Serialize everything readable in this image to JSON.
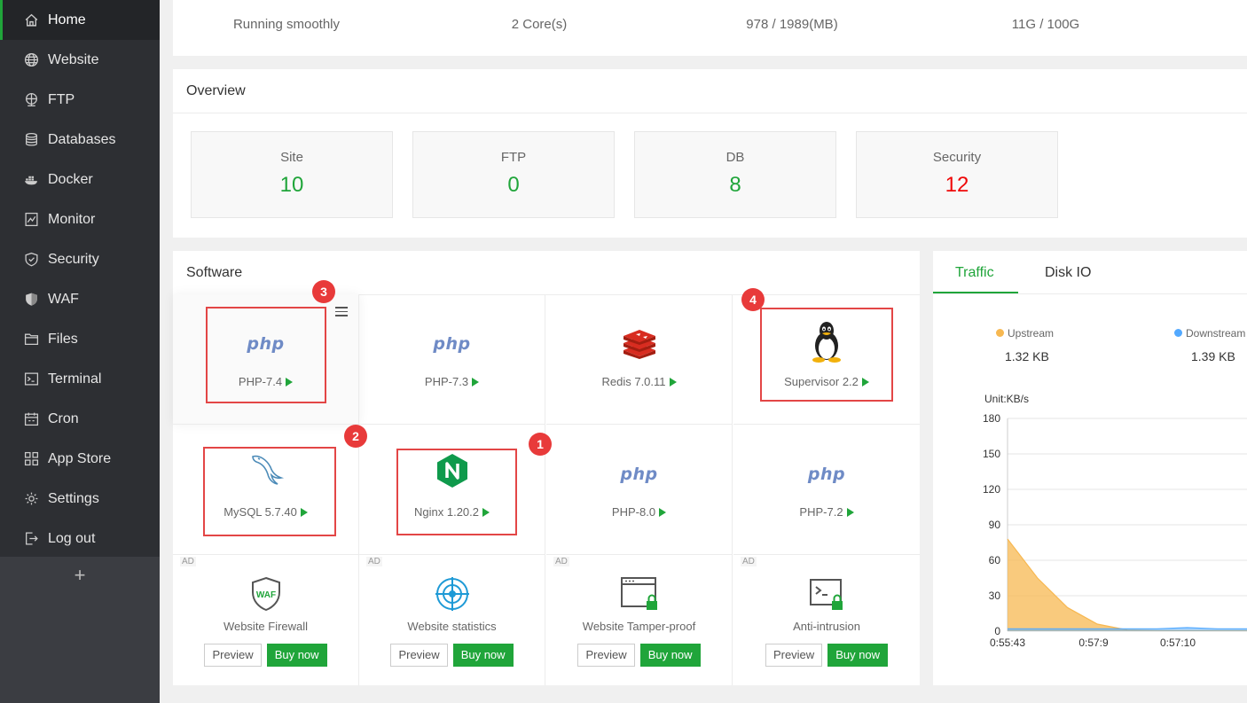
{
  "sidebar": {
    "items": [
      {
        "label": "Home",
        "icon": "home-icon",
        "active": true
      },
      {
        "label": "Website",
        "icon": "globe-icon"
      },
      {
        "label": "FTP",
        "icon": "ftp-icon"
      },
      {
        "label": "Databases",
        "icon": "database-icon"
      },
      {
        "label": "Docker",
        "icon": "docker-icon"
      },
      {
        "label": "Monitor",
        "icon": "monitor-icon"
      },
      {
        "label": "Security",
        "icon": "shield-icon"
      },
      {
        "label": "WAF",
        "icon": "waf-shield-icon"
      },
      {
        "label": "Files",
        "icon": "folder-icon"
      },
      {
        "label": "Terminal",
        "icon": "terminal-icon"
      },
      {
        "label": "Cron",
        "icon": "calendar-icon"
      },
      {
        "label": "App Store",
        "icon": "grid-icon"
      },
      {
        "label": "Settings",
        "icon": "gear-icon"
      },
      {
        "label": "Log out",
        "icon": "logout-icon"
      }
    ],
    "add_label": "+"
  },
  "status": {
    "load": "Running smoothly",
    "cpu": "2 Core(s)",
    "memory": "978 / 1989(MB)",
    "disk": "11G / 100G"
  },
  "overview": {
    "title": "Overview",
    "boxes": [
      {
        "label": "Site",
        "value": "10"
      },
      {
        "label": "FTP",
        "value": "0"
      },
      {
        "label": "DB",
        "value": "8"
      },
      {
        "label": "Security",
        "value": "12"
      }
    ]
  },
  "software": {
    "title": "Software",
    "items": [
      {
        "name": "PHP-7.4",
        "logo": "php"
      },
      {
        "name": "PHP-7.3",
        "logo": "php"
      },
      {
        "name": "Redis 7.0.11",
        "logo": "redis"
      },
      {
        "name": "Supervisor 2.2",
        "logo": "linux"
      },
      {
        "name": "MySQL 5.7.40",
        "logo": "mysql"
      },
      {
        "name": "Nginx 1.20.2",
        "logo": "nginx"
      },
      {
        "name": "PHP-8.0",
        "logo": "php"
      },
      {
        "name": "PHP-7.2",
        "logo": "php"
      }
    ],
    "php_logo_text": "php",
    "ads": [
      {
        "tag": "AD",
        "name": "Website Firewall",
        "icon_text": "WAF"
      },
      {
        "tag": "AD",
        "name": "Website statistics"
      },
      {
        "tag": "AD",
        "name": "Website Tamper-proof"
      },
      {
        "tag": "AD",
        "name": "Anti-intrusion"
      }
    ],
    "preview_label": "Preview",
    "buy_label": "Buy now",
    "badges": [
      "3",
      "2",
      "1",
      "4"
    ]
  },
  "traffic": {
    "tabs": [
      "Traffic",
      "Disk IO"
    ],
    "upstream_label": "Upstream",
    "upstream_value": "1.32 KB",
    "downstream_label": "Downstream",
    "downstream_value": "1.39 KB",
    "colors": {
      "upstream": "#f7b851",
      "downstream": "#52a9ff"
    }
  },
  "chart_data": {
    "type": "area",
    "ylabel": "Unit:KB/s",
    "ylim": [
      0,
      180
    ],
    "yticks": [
      0,
      30,
      60,
      90,
      120,
      150,
      180
    ],
    "x": [
      "0:55:43",
      "0:57:9",
      "0:57:10"
    ],
    "series": [
      {
        "name": "Upstream",
        "values": [
          78,
          45,
          20,
          6,
          1,
          0.5,
          0.5,
          0.5,
          0.5
        ]
      },
      {
        "name": "Downstream",
        "values": [
          2,
          2,
          2,
          2,
          2,
          2,
          3,
          2,
          2
        ]
      }
    ]
  }
}
